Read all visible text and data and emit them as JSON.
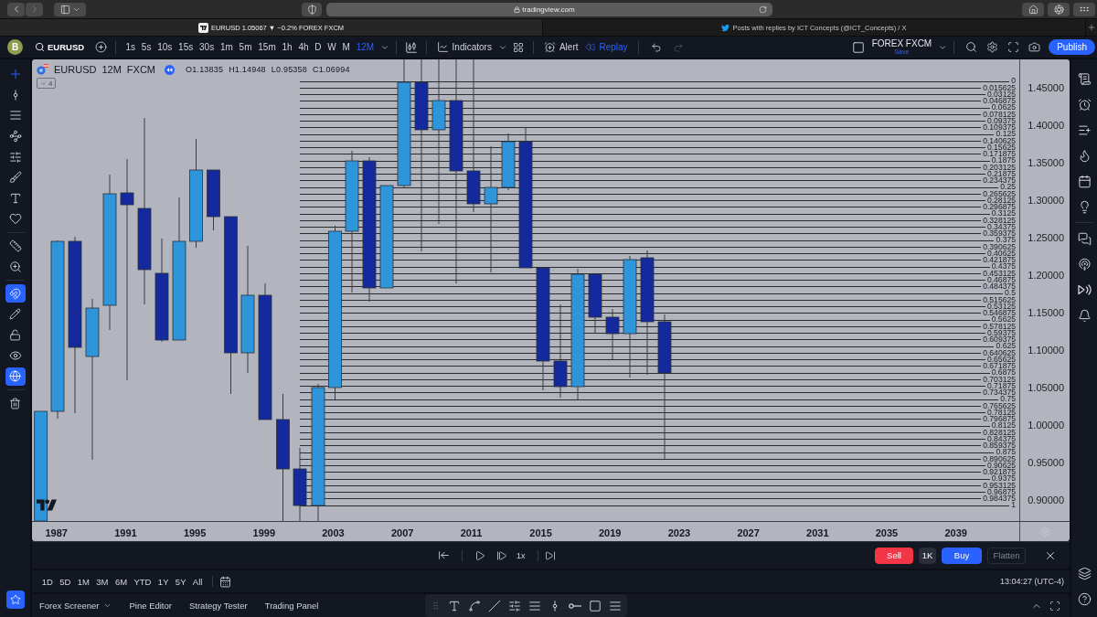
{
  "browser": {
    "address": "tradingview.com",
    "forward_disabled": true,
    "tabs": [
      {
        "title": "EURUSD 1.05067 ▼ −0.2% FOREX FXCM",
        "selected": true
      },
      {
        "title": "Posts with replies by ICT Concepts (@ICT_Concepts) / X",
        "selected": false
      }
    ]
  },
  "header": {
    "avatar": "B",
    "symbol": "EURUSD",
    "intervals": [
      {
        "label": "1s",
        "selected": false
      },
      {
        "label": "5s",
        "selected": false
      },
      {
        "label": "10s",
        "selected": false
      },
      {
        "label": "15s",
        "selected": false
      },
      {
        "label": "30s",
        "selected": false
      },
      {
        "label": "1m",
        "selected": false
      },
      {
        "label": "5m",
        "selected": false
      },
      {
        "label": "15m",
        "selected": false
      },
      {
        "label": "1h",
        "selected": false
      },
      {
        "label": "4h",
        "selected": false
      },
      {
        "label": "D",
        "selected": false
      },
      {
        "label": "W",
        "selected": false
      },
      {
        "label": "M",
        "selected": false
      },
      {
        "label": "12M",
        "selected": true
      }
    ],
    "indicators": "Indicators",
    "alert": "Alert",
    "replay": "Replay",
    "redo_disabled": true,
    "layout_name": "FOREX FXCM",
    "save": "Save",
    "publish": "Publish"
  },
  "left_toolbar": {
    "crosshair_selected": true,
    "magnet_on": true,
    "sync_on": true
  },
  "legend": {
    "symbol": "EURUSD",
    "interval": "12M",
    "source": "FXCM",
    "ohlc": [
      "O1.13835",
      "H1.14948",
      "L0.95358",
      "C1.06994"
    ],
    "hidden_count": "4"
  },
  "chart": {
    "fib_levels": [
      "0",
      "0.015625",
      "0.03125",
      "0.046875",
      "0.0625",
      "0.078125",
      "0.09375",
      "0.109375",
      "0.125",
      "0.140625",
      "0.15625",
      "0.171875",
      "0.1875",
      "0.203125",
      "0.21875",
      "0.234375",
      "0.25",
      "0.265625",
      "0.28125",
      "0.296875",
      "0.3125",
      "0.328125",
      "0.34375",
      "0.359375",
      "0.375",
      "0.390625",
      "0.40625",
      "0.421875",
      "0.4375",
      "0.453125",
      "0.46875",
      "0.484375",
      "0.5",
      "0.515625",
      "0.53125",
      "0.546875",
      "0.5625",
      "0.578125",
      "0.59375",
      "0.609375",
      "0.625",
      "0.640625",
      "0.65625",
      "0.671875",
      "0.6875",
      "0.703125",
      "0.71875",
      "0.734375",
      "0.75",
      "0.765625",
      "0.78125",
      "0.796875",
      "0.8125",
      "0.828125",
      "0.84375",
      "0.859375",
      "0.875",
      "0.890625",
      "0.90625",
      "0.921875",
      "0.9375",
      "0.953125",
      "0.96875",
      "0.984375",
      "1"
    ],
    "price_axis": [
      "1.45000",
      "1.40000",
      "1.35000",
      "1.30000",
      "1.25000",
      "1.20000",
      "1.15000",
      "1.10000",
      "1.05000",
      "1.00000",
      "0.95000",
      "0.90000"
    ],
    "time_axis": [
      "1987",
      "1991",
      "1995",
      "1999",
      "2003",
      "2007",
      "2011",
      "2015",
      "2019",
      "2023",
      "2027",
      "2031",
      "2035",
      "2039"
    ]
  },
  "replay_bar": {
    "speed": "1x",
    "sell": "Sell",
    "quantity": "1K",
    "buy": "Buy",
    "flatten": {
      "label": "Flatten",
      "disabled": true
    }
  },
  "range_bar": {
    "ranges": [
      "1D",
      "5D",
      "1M",
      "3M",
      "6M",
      "YTD",
      "1Y",
      "5Y",
      "All"
    ],
    "clock": "13:04:27 (UTC-4)"
  },
  "bottom_bar": {
    "tabs": [
      {
        "label": "Forex Screener",
        "dropdown": true
      },
      {
        "label": "Pine Editor",
        "dropdown": false
      },
      {
        "label": "Strategy Tester",
        "dropdown": false
      },
      {
        "label": "Trading Panel",
        "dropdown": false
      }
    ]
  }
}
